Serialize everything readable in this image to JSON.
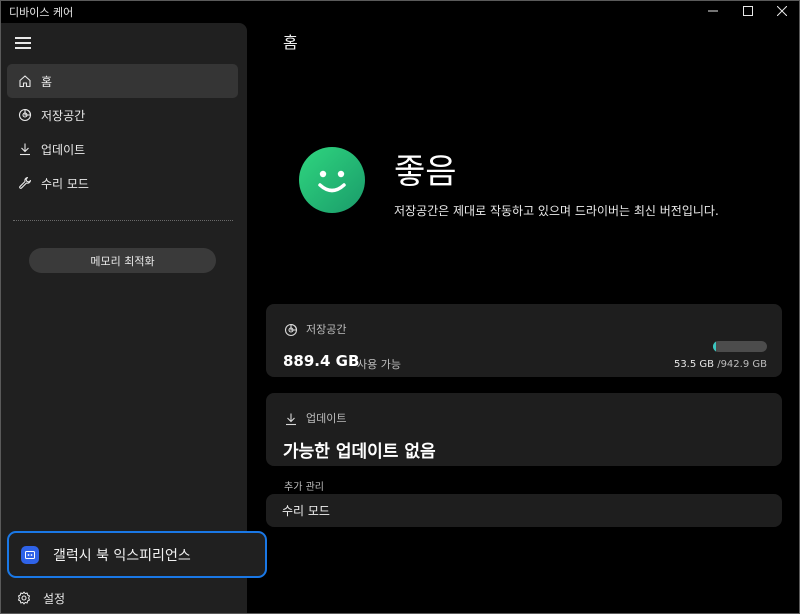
{
  "window": {
    "title": "디바이스 케어",
    "controls": {
      "minimize": "—",
      "maximize": "☐",
      "close": "✕"
    }
  },
  "sidebar": {
    "menu_icon": "hamburger-icon",
    "items": [
      {
        "label": "홈",
        "icon": "home-icon",
        "active": true
      },
      {
        "label": "저장공간",
        "icon": "storage-icon",
        "active": false
      },
      {
        "label": "업데이트",
        "icon": "download-icon",
        "active": false
      },
      {
        "label": "수리 모드",
        "icon": "wrench-icon",
        "active": false
      }
    ],
    "optimize_button": "메모리 최적화",
    "promo": {
      "label": "갤럭시 북 익스피리언스",
      "icon": "galaxy-book-app-icon"
    },
    "settings": {
      "label": "설정",
      "icon": "gear-icon"
    }
  },
  "main": {
    "page_title": "홈",
    "status": {
      "title": "좋음",
      "description": "저장공간은 제대로 작동하고 있으며 드라이버는 최신 버전입니다.",
      "icon": "smile-face-icon",
      "color": "#22b873"
    },
    "storage_card": {
      "title": "저장공간",
      "free_value": "889.4 GB",
      "free_label": "사용 가능",
      "used": "53.5 GB",
      "total": "/942.9 GB",
      "used_fraction": 0.057,
      "bar_color": "#3bc6c0"
    },
    "update_card": {
      "title": "업데이트",
      "status": "가능한 업데이트 없음"
    },
    "extra": {
      "section_label": "추가 관리",
      "repair_mode": "수리 모드"
    }
  },
  "colors": {
    "accent_outline": "#1a78e6",
    "sidebar_bg": "#202020",
    "card_bg": "#1e1e1e"
  }
}
